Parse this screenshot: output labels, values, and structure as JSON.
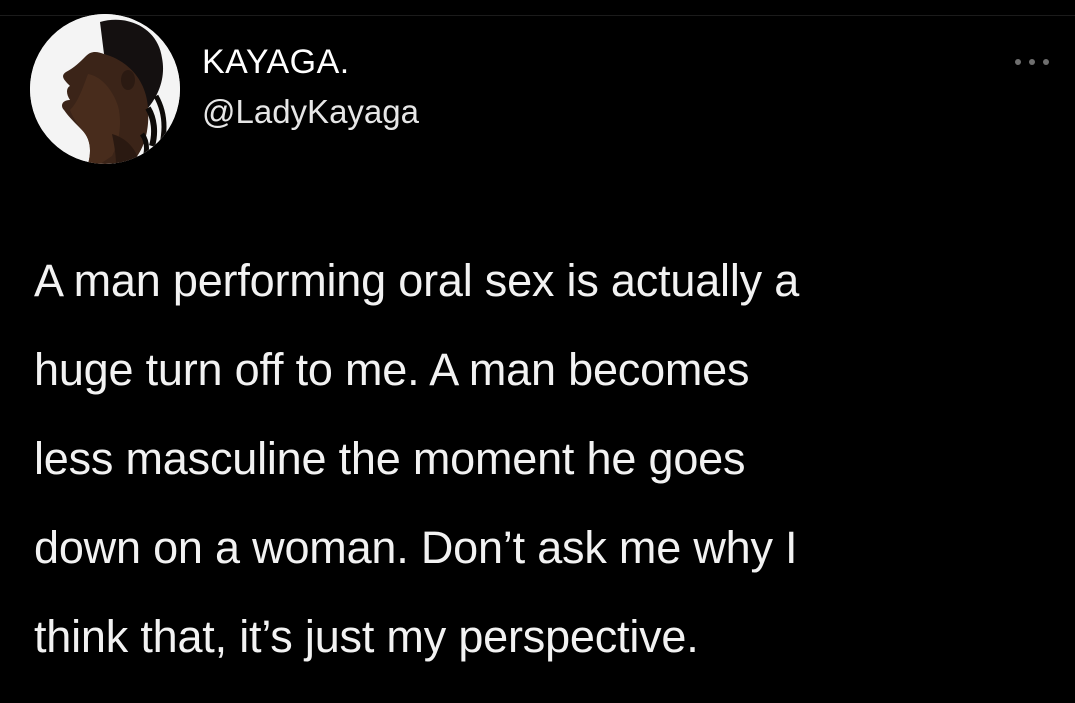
{
  "tweet": {
    "author": {
      "display_name": "KAYAGA.",
      "handle": "@LadyKayaga",
      "avatar_icon": "profile-photo-woman-portrait"
    },
    "more_icon": "more-horizontal-icon",
    "text_lines": [
      "A man performing oral sex is actually a",
      "huge turn off to me. A man becomes",
      "less masculine the moment he goes",
      "down on a woman. Don’t ask me why I",
      "think that, it’s just my perspective."
    ]
  },
  "colors": {
    "background": "#000000",
    "text": "#f2f2f2",
    "secondary_text": "#e6e6e6",
    "icon_muted": "#6f6f6f"
  }
}
